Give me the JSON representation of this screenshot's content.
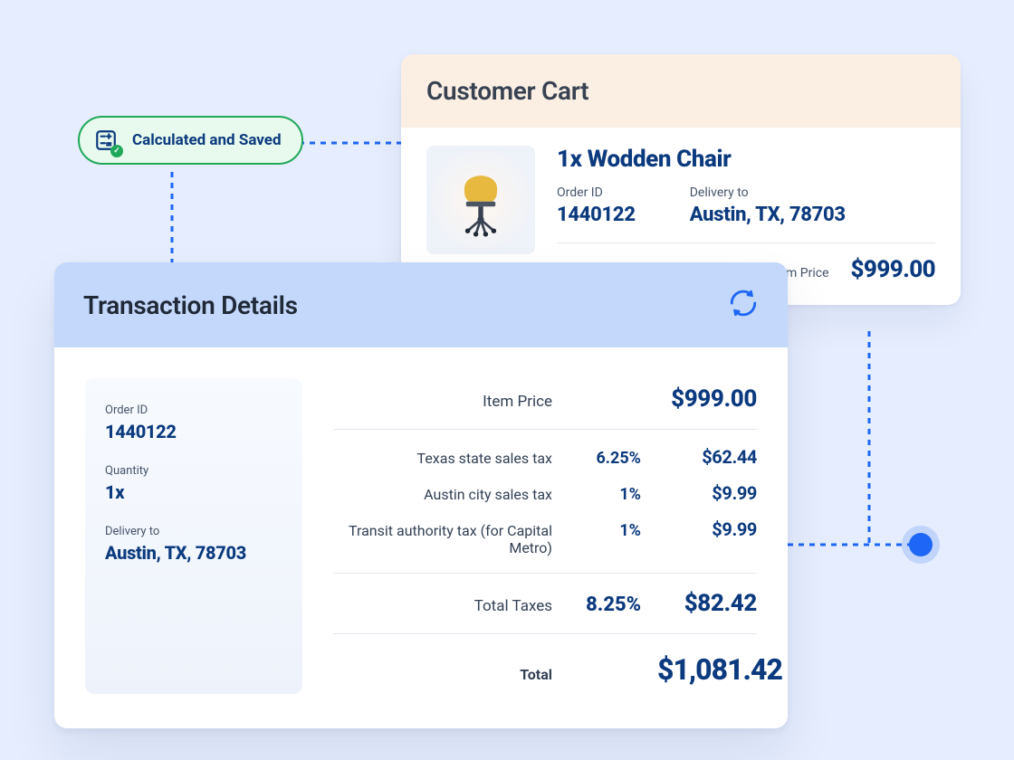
{
  "status_pill": {
    "label": "Calculated and Saved"
  },
  "cart": {
    "title": "Customer Cart",
    "item_title": "1x Wodden Chair",
    "order_id_label": "Order ID",
    "order_id": "1440122",
    "delivery_label": "Delivery to",
    "delivery_to": "Austin, TX, 78703",
    "price_label": "Item Price",
    "price": "$999.00"
  },
  "txn": {
    "title": "Transaction Details",
    "summary": {
      "order_id_label": "Order ID",
      "order_id": "1440122",
      "qty_label": "Quantity",
      "qty": "1x",
      "delivery_label": "Delivery to",
      "delivery_to": "Austin, TX, 78703"
    },
    "lines": {
      "item_price_label": "Item Price",
      "item_price": "$999.00",
      "tax1_label": "Texas state sales tax",
      "tax1_pct": "6.25%",
      "tax1_amt": "$62.44",
      "tax2_label": "Austin city sales tax",
      "tax2_pct": "1%",
      "tax2_amt": "$9.99",
      "tax3_label": "Transit authority tax (for Capital Metro)",
      "tax3_pct": "1%",
      "tax3_amt": "$9.99",
      "total_tax_label": "Total Taxes",
      "total_tax_pct": "8.25%",
      "total_tax_amt": "$82.42",
      "total_label": "Total",
      "total_amt": "$1,081.42"
    }
  }
}
